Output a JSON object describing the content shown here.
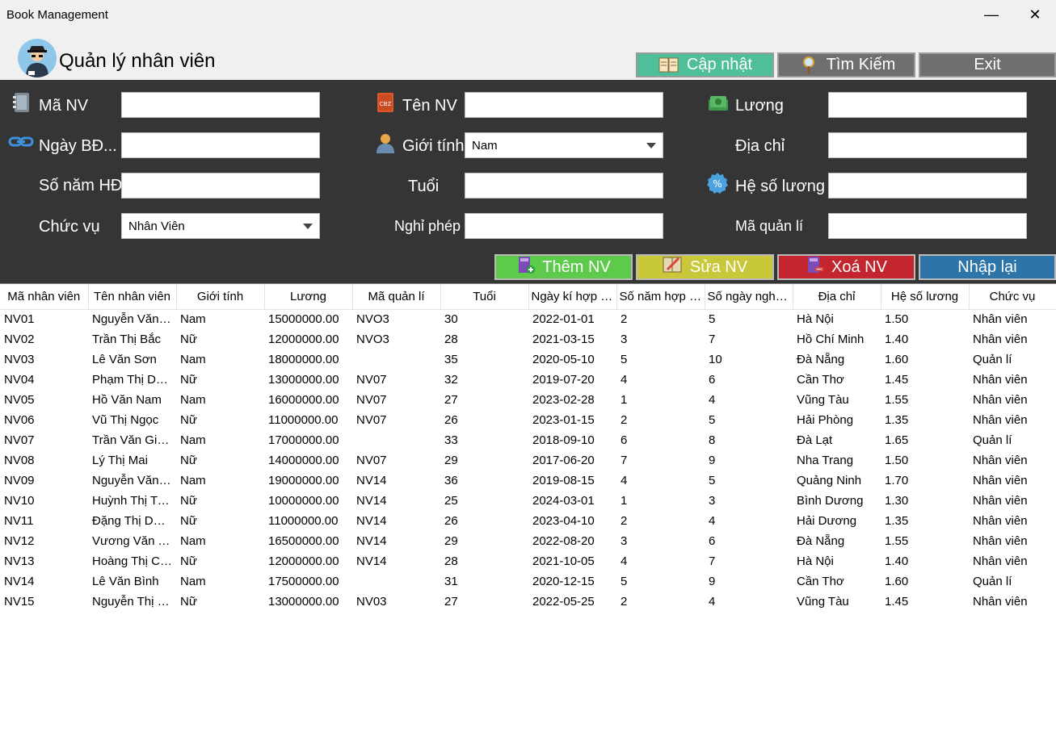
{
  "window": {
    "title": "Book Management",
    "minimize": "—",
    "close": "✕"
  },
  "header": {
    "title": "Quản lý nhân viên"
  },
  "top_buttons": {
    "update": "Cập nhật",
    "search": "Tìm Kiếm",
    "exit": "Exit"
  },
  "form": {
    "ma_nv": {
      "label": "Mã NV",
      "value": ""
    },
    "ten_nv": {
      "label": "Tên NV",
      "value": ""
    },
    "luong": {
      "label": "Lương",
      "value": ""
    },
    "ngay_bd": {
      "label": "Ngày BĐ...",
      "value": ""
    },
    "gioi_tinh": {
      "label": "Giới tính",
      "value": "Nam"
    },
    "dia_chi": {
      "label": "Địa chỉ",
      "value": ""
    },
    "so_nam_hd": {
      "label": "Số năm HĐ",
      "value": ""
    },
    "tuoi": {
      "label": "Tuổi",
      "value": ""
    },
    "he_so_luong": {
      "label": "Hệ số lương",
      "value": ""
    },
    "chuc_vu": {
      "label": "Chức vụ",
      "value": "Nhân Viên"
    },
    "nghi_phep": {
      "label": "Nghỉ phép",
      "value": ""
    },
    "ma_quan_li": {
      "label": "Mã quản lí",
      "value": ""
    }
  },
  "actions": {
    "add": "Thêm NV",
    "edit": "Sửa NV",
    "delete": "Xoá NV",
    "reset": "Nhập lại"
  },
  "colors": {
    "update_btn": "#4fbf9a",
    "gray_btn": "#6f6f6f",
    "add_btn": "#5dca4b",
    "edit_btn": "#c9c73a",
    "delete_btn": "#c3262f",
    "reset_btn": "#2d74a8",
    "panel": "#353535"
  },
  "table": {
    "columns": [
      "Mã nhân viên",
      "Tên nhân viên",
      "Giới tính",
      "Lương",
      "Mã quản lí",
      "Tuổi",
      "Ngày kí hợp đ...",
      "Số năm hợp đ...",
      "Số ngày nghỉ ...",
      "Địa chỉ",
      "Hệ số lương",
      "Chức vụ"
    ],
    "rows": [
      [
        "NV01",
        "Nguyễn Văn A...",
        "Nam",
        "15000000.00",
        "NVO3",
        "30",
        "2022-01-01",
        "2",
        "5",
        "Hà Nội",
        "1.50",
        "Nhân viên"
      ],
      [
        "NV02",
        "Trần Thị Bắc",
        "Nữ",
        "12000000.00",
        "NVO3",
        "28",
        "2021-03-15",
        "3",
        "7",
        "Hồ Chí Minh",
        "1.40",
        "Nhân viên"
      ],
      [
        "NV03",
        "Lê Văn Sơn",
        "Nam",
        "18000000.00",
        "",
        "35",
        "2020-05-10",
        "5",
        "10",
        "Đà Nẵng",
        "1.60",
        "Quản lí"
      ],
      [
        "NV04",
        "Phạm Thị Dung",
        "Nữ",
        "13000000.00",
        "NV07",
        "32",
        "2019-07-20",
        "4",
        "6",
        "Cần Thơ",
        "1.45",
        "Nhân viên"
      ],
      [
        "NV05",
        "Hồ Văn Nam",
        "Nam",
        "16000000.00",
        "NV07",
        "27",
        "2023-02-28",
        "1",
        "4",
        "Vũng Tàu",
        "1.55",
        "Nhân viên"
      ],
      [
        "NV06",
        "Vũ Thị Ngọc",
        "Nữ",
        "11000000.00",
        "NV07",
        "26",
        "2023-01-15",
        "2",
        "5",
        "Hải Phòng",
        "1.35",
        "Nhân viên"
      ],
      [
        "NV07",
        "Trần Văn Giang",
        "Nam",
        "17000000.00",
        "",
        "33",
        "2018-09-10",
        "6",
        "8",
        "Đà Lạt",
        "1.65",
        "Quản lí"
      ],
      [
        "NV08",
        "Lý Thị Mai",
        "Nữ",
        "14000000.00",
        "NV07",
        "29",
        "2017-06-20",
        "7",
        "9",
        "Nha Trang",
        "1.50",
        "Nhân viên"
      ],
      [
        "NV09",
        "Nguyễn Văn H...",
        "Nam",
        "19000000.00",
        "NV14",
        "36",
        "2019-08-15",
        "4",
        "5",
        "Quảng Ninh",
        "1.70",
        "Nhân viên"
      ],
      [
        "NV10",
        "Huỳnh Thị Tra...",
        "Nữ",
        "10000000.00",
        "NV14",
        "25",
        "2024-03-01",
        "1",
        "3",
        "Bình Dương",
        "1.30",
        "Nhân viên"
      ],
      [
        "NV11",
        "Đặng Thị Dươ...",
        "Nữ",
        "11000000.00",
        "NV14",
        "26",
        "2023-04-10",
        "2",
        "4",
        "Hải Dương",
        "1.35",
        "Nhân viên"
      ],
      [
        "NV12",
        "Vương Văn Th...",
        "Nam",
        "16500000.00",
        "NV14",
        "29",
        "2022-08-20",
        "3",
        "6",
        "Đà Nẵng",
        "1.55",
        "Nhân viên"
      ],
      [
        "NV13",
        "Hoàng Thị Chi...",
        "Nữ",
        "12000000.00",
        "NV14",
        "28",
        "2021-10-05",
        "4",
        "7",
        "Hà Nội",
        "1.40",
        "Nhân viên"
      ],
      [
        "NV14",
        "Lê Văn Bình",
        "Nam",
        "17500000.00",
        "",
        "31",
        "2020-12-15",
        "5",
        "9",
        "Cần Thơ",
        "1.60",
        "Quản lí"
      ],
      [
        "NV15",
        "Nguyễn Thị Ph...",
        "Nữ",
        "13000000.00",
        "NV03",
        "27",
        "2022-05-25",
        "2",
        "4",
        "Vũng Tàu",
        "1.45",
        "Nhân viên"
      ]
    ]
  }
}
